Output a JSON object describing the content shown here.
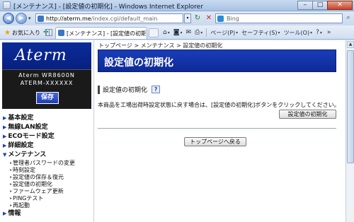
{
  "window": {
    "title": "[メンテナンス] - [設定値の初期化] - Windows Internet Explorer",
    "minimize": "–",
    "maximize": "□",
    "close": "✕"
  },
  "address": {
    "url_host": "http://aterm.me",
    "url_path": "/index.cgi/default_main",
    "search_placeholder": "Bing"
  },
  "toolbar": {
    "favorites_label": "お気に入り",
    "tab_label": "[メンテナンス] - [設定値の初期化]",
    "page_label": "ページ(P)",
    "safety_label": "セーフティ(S)",
    "tools_label": "ツール(O)",
    "help_label": "?"
  },
  "sidebar": {
    "logo": "Aterm",
    "model": "Aterm WR8600N",
    "serial": "ATERM-XXXXXX",
    "save_label": "保存",
    "menu": [
      {
        "label": "基本設定"
      },
      {
        "label": "無線LAN設定"
      },
      {
        "label": "ECOモード設定"
      },
      {
        "label": "詳細設定"
      },
      {
        "label": "メンテナンス"
      },
      {
        "label": "情報"
      }
    ],
    "submenu": [
      {
        "label": "管理者パスワードの変更"
      },
      {
        "label": "時刻設定"
      },
      {
        "label": "設定値の保存＆復元"
      },
      {
        "label": "設定値の初期化"
      },
      {
        "label": "ファームウェア更新"
      },
      {
        "label": "PINGテスト"
      },
      {
        "label": "再起動"
      }
    ]
  },
  "main": {
    "breadcrumb": "トップページ > メンテナンス > 設定値の初期化",
    "page_title": "設定値の初期化",
    "section_title": "設定値の初期化",
    "help_icon": "?",
    "description": "本商品を工場出荷時設定状態に戻す場合は、[設定値の初期化]ボタンをクリックしてください。",
    "reset_button": "設定値の初期化",
    "back_button": "トップページへ戻る"
  },
  "colors": {
    "header_blue": "#1a3db8",
    "logo_blue": "#0b2c9a",
    "menu_marker": "#1a3fb8"
  }
}
